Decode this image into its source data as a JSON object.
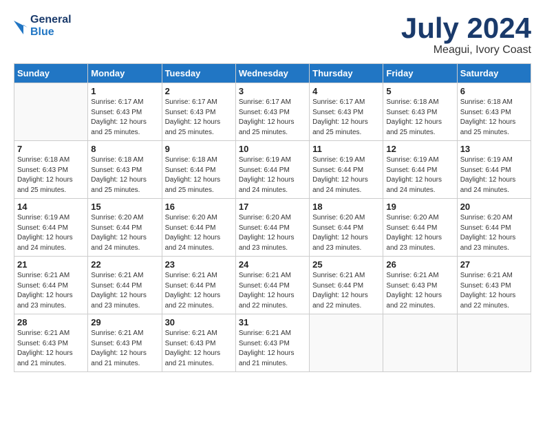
{
  "header": {
    "logo_line1": "General",
    "logo_line2": "Blue",
    "month": "July 2024",
    "location": "Meagui, Ivory Coast"
  },
  "days_of_week": [
    "Sunday",
    "Monday",
    "Tuesday",
    "Wednesday",
    "Thursday",
    "Friday",
    "Saturday"
  ],
  "weeks": [
    [
      {
        "day": "",
        "info": ""
      },
      {
        "day": "1",
        "info": "Sunrise: 6:17 AM\nSunset: 6:43 PM\nDaylight: 12 hours\nand 25 minutes."
      },
      {
        "day": "2",
        "info": "Sunrise: 6:17 AM\nSunset: 6:43 PM\nDaylight: 12 hours\nand 25 minutes."
      },
      {
        "day": "3",
        "info": "Sunrise: 6:17 AM\nSunset: 6:43 PM\nDaylight: 12 hours\nand 25 minutes."
      },
      {
        "day": "4",
        "info": "Sunrise: 6:17 AM\nSunset: 6:43 PM\nDaylight: 12 hours\nand 25 minutes."
      },
      {
        "day": "5",
        "info": "Sunrise: 6:18 AM\nSunset: 6:43 PM\nDaylight: 12 hours\nand 25 minutes."
      },
      {
        "day": "6",
        "info": "Sunrise: 6:18 AM\nSunset: 6:43 PM\nDaylight: 12 hours\nand 25 minutes."
      }
    ],
    [
      {
        "day": "7",
        "info": "Sunrise: 6:18 AM\nSunset: 6:43 PM\nDaylight: 12 hours\nand 25 minutes."
      },
      {
        "day": "8",
        "info": "Sunrise: 6:18 AM\nSunset: 6:43 PM\nDaylight: 12 hours\nand 25 minutes."
      },
      {
        "day": "9",
        "info": "Sunrise: 6:18 AM\nSunset: 6:44 PM\nDaylight: 12 hours\nand 25 minutes."
      },
      {
        "day": "10",
        "info": "Sunrise: 6:19 AM\nSunset: 6:44 PM\nDaylight: 12 hours\nand 24 minutes."
      },
      {
        "day": "11",
        "info": "Sunrise: 6:19 AM\nSunset: 6:44 PM\nDaylight: 12 hours\nand 24 minutes."
      },
      {
        "day": "12",
        "info": "Sunrise: 6:19 AM\nSunset: 6:44 PM\nDaylight: 12 hours\nand 24 minutes."
      },
      {
        "day": "13",
        "info": "Sunrise: 6:19 AM\nSunset: 6:44 PM\nDaylight: 12 hours\nand 24 minutes."
      }
    ],
    [
      {
        "day": "14",
        "info": "Sunrise: 6:19 AM\nSunset: 6:44 PM\nDaylight: 12 hours\nand 24 minutes."
      },
      {
        "day": "15",
        "info": "Sunrise: 6:20 AM\nSunset: 6:44 PM\nDaylight: 12 hours\nand 24 minutes."
      },
      {
        "day": "16",
        "info": "Sunrise: 6:20 AM\nSunset: 6:44 PM\nDaylight: 12 hours\nand 24 minutes."
      },
      {
        "day": "17",
        "info": "Sunrise: 6:20 AM\nSunset: 6:44 PM\nDaylight: 12 hours\nand 23 minutes."
      },
      {
        "day": "18",
        "info": "Sunrise: 6:20 AM\nSunset: 6:44 PM\nDaylight: 12 hours\nand 23 minutes."
      },
      {
        "day": "19",
        "info": "Sunrise: 6:20 AM\nSunset: 6:44 PM\nDaylight: 12 hours\nand 23 minutes."
      },
      {
        "day": "20",
        "info": "Sunrise: 6:20 AM\nSunset: 6:44 PM\nDaylight: 12 hours\nand 23 minutes."
      }
    ],
    [
      {
        "day": "21",
        "info": "Sunrise: 6:21 AM\nSunset: 6:44 PM\nDaylight: 12 hours\nand 23 minutes."
      },
      {
        "day": "22",
        "info": "Sunrise: 6:21 AM\nSunset: 6:44 PM\nDaylight: 12 hours\nand 23 minutes."
      },
      {
        "day": "23",
        "info": "Sunrise: 6:21 AM\nSunset: 6:44 PM\nDaylight: 12 hours\nand 22 minutes."
      },
      {
        "day": "24",
        "info": "Sunrise: 6:21 AM\nSunset: 6:44 PM\nDaylight: 12 hours\nand 22 minutes."
      },
      {
        "day": "25",
        "info": "Sunrise: 6:21 AM\nSunset: 6:44 PM\nDaylight: 12 hours\nand 22 minutes."
      },
      {
        "day": "26",
        "info": "Sunrise: 6:21 AM\nSunset: 6:43 PM\nDaylight: 12 hours\nand 22 minutes."
      },
      {
        "day": "27",
        "info": "Sunrise: 6:21 AM\nSunset: 6:43 PM\nDaylight: 12 hours\nand 22 minutes."
      }
    ],
    [
      {
        "day": "28",
        "info": "Sunrise: 6:21 AM\nSunset: 6:43 PM\nDaylight: 12 hours\nand 21 minutes."
      },
      {
        "day": "29",
        "info": "Sunrise: 6:21 AM\nSunset: 6:43 PM\nDaylight: 12 hours\nand 21 minutes."
      },
      {
        "day": "30",
        "info": "Sunrise: 6:21 AM\nSunset: 6:43 PM\nDaylight: 12 hours\nand 21 minutes."
      },
      {
        "day": "31",
        "info": "Sunrise: 6:21 AM\nSunset: 6:43 PM\nDaylight: 12 hours\nand 21 minutes."
      },
      {
        "day": "",
        "info": ""
      },
      {
        "day": "",
        "info": ""
      },
      {
        "day": "",
        "info": ""
      }
    ]
  ]
}
